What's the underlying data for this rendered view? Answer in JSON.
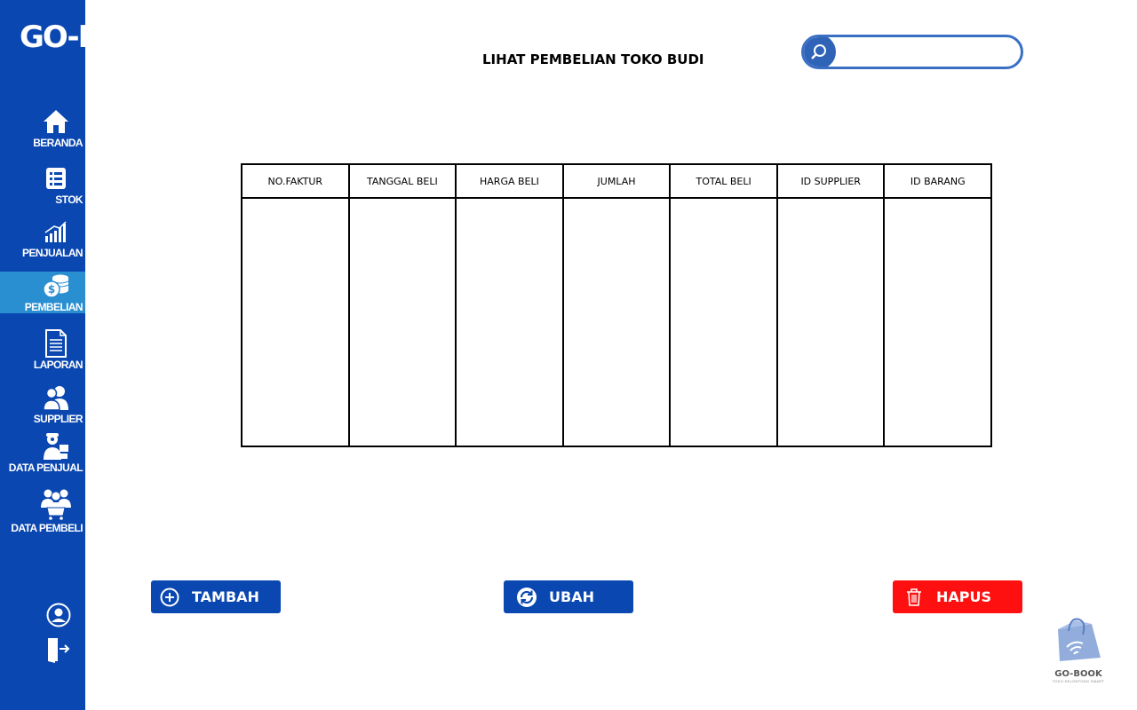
{
  "app": {
    "logo_part1": "GO-",
    "logo_part2": "BOOK",
    "accent": "#0a47b1",
    "active_item": "#2a8fd1",
    "danger": "#ff1010"
  },
  "sidebar": {
    "items": [
      {
        "label": "BERANDA",
        "icon": "home-icon"
      },
      {
        "label": "STOK",
        "icon": "list-icon"
      },
      {
        "label": "PENJUALAN",
        "icon": "bar-chart-icon"
      },
      {
        "label": "PEMBELIAN",
        "icon": "coins-icon",
        "active": true
      },
      {
        "label": "LAPORAN",
        "icon": "document-icon"
      },
      {
        "label": "SUPPLIER",
        "icon": "users-icon"
      },
      {
        "label": "DATA PENJUAL",
        "icon": "seller-icon"
      },
      {
        "label": "DATA PEMBELI",
        "icon": "buyers-icon"
      }
    ],
    "bottom": [
      "user-icon",
      "logout-icon"
    ]
  },
  "header": {
    "title": "LIHAT PEMBELIAN TOKO BUDI",
    "search_value": ""
  },
  "table": {
    "columns": [
      "NO.FAKTUR",
      "TANGGAL BELI",
      "HARGA BELI",
      "JUMLAH",
      "TOTAL BELI",
      "ID SUPPLIER",
      "ID BARANG"
    ],
    "rows": []
  },
  "actions": {
    "add_label": "TAMBAH",
    "edit_label": "UBAH",
    "delete_label": "HAPUS"
  },
  "brand": {
    "name": "GO-BOOK",
    "tagline": "TOKO KELONTONG SMART"
  }
}
